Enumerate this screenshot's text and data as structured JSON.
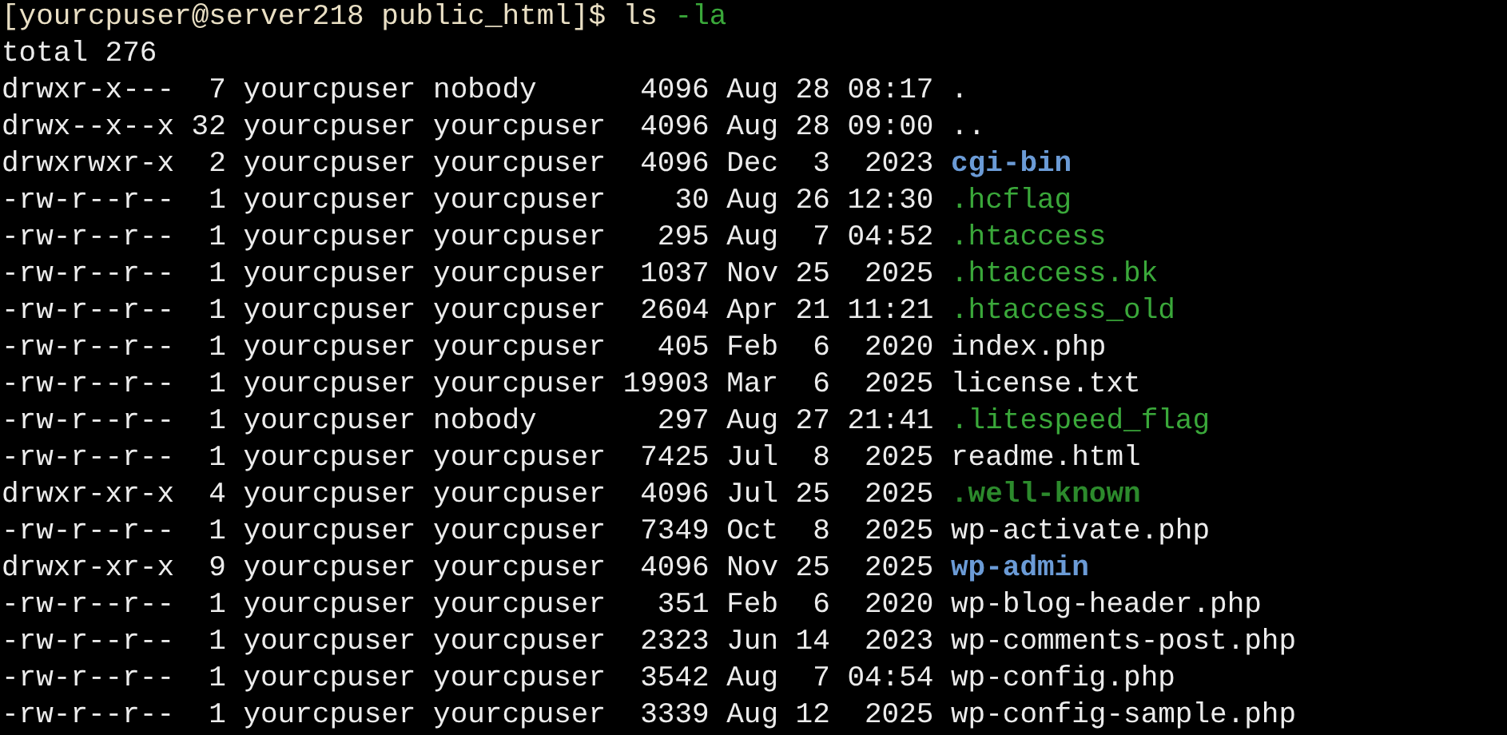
{
  "prompt": {
    "context": "[yourcpuser@server218 public_html]$",
    "command": "ls",
    "option": "-la"
  },
  "total": "total 276",
  "entries": [
    {
      "perms": "drwxr-x---",
      "links": "7",
      "owner": "yourcpuser",
      "group": "nobody",
      "size": "4096",
      "month": "Aug",
      "day": "28",
      "time": "08:17",
      "name": ".",
      "kind": "plain"
    },
    {
      "perms": "drwx--x--x",
      "links": "32",
      "owner": "yourcpuser",
      "group": "yourcpuser",
      "size": "4096",
      "month": "Aug",
      "day": "28",
      "time": "09:00",
      "name": "..",
      "kind": "plain"
    },
    {
      "perms": "drwxrwxr-x",
      "links": "2",
      "owner": "yourcpuser",
      "group": "yourcpuser",
      "size": "4096",
      "month": "Dec",
      "day": "3",
      "time": "2023",
      "name": "cgi-bin",
      "kind": "directory"
    },
    {
      "perms": "-rw-r--r--",
      "links": "1",
      "owner": "yourcpuser",
      "group": "yourcpuser",
      "size": "30",
      "month": "Aug",
      "day": "26",
      "time": "12:30",
      "name": ".hcflag",
      "kind": "hidden"
    },
    {
      "perms": "-rw-r--r--",
      "links": "1",
      "owner": "yourcpuser",
      "group": "yourcpuser",
      "size": "295",
      "month": "Aug",
      "day": "7",
      "time": "04:52",
      "name": ".htaccess",
      "kind": "hidden"
    },
    {
      "perms": "-rw-r--r--",
      "links": "1",
      "owner": "yourcpuser",
      "group": "yourcpuser",
      "size": "1037",
      "month": "Nov",
      "day": "25",
      "time": "2025",
      "name": ".htaccess.bk",
      "kind": "hidden"
    },
    {
      "perms": "-rw-r--r--",
      "links": "1",
      "owner": "yourcpuser",
      "group": "yourcpuser",
      "size": "2604",
      "month": "Apr",
      "day": "21",
      "time": "11:21",
      "name": ".htaccess_old",
      "kind": "hidden"
    },
    {
      "perms": "-rw-r--r--",
      "links": "1",
      "owner": "yourcpuser",
      "group": "yourcpuser",
      "size": "405",
      "month": "Feb",
      "day": "6",
      "time": "2020",
      "name": "index.php",
      "kind": "plain"
    },
    {
      "perms": "-rw-r--r--",
      "links": "1",
      "owner": "yourcpuser",
      "group": "yourcpuser",
      "size": "19903",
      "month": "Mar",
      "day": "6",
      "time": "2025",
      "name": "license.txt",
      "kind": "plain"
    },
    {
      "perms": "-rw-r--r--",
      "links": "1",
      "owner": "yourcpuser",
      "group": "nobody",
      "size": "297",
      "month": "Aug",
      "day": "27",
      "time": "21:41",
      "name": ".litespeed_flag",
      "kind": "hidden"
    },
    {
      "perms": "-rw-r--r--",
      "links": "1",
      "owner": "yourcpuser",
      "group": "yourcpuser",
      "size": "7425",
      "month": "Jul",
      "day": "8",
      "time": "2025",
      "name": "readme.html",
      "kind": "plain"
    },
    {
      "perms": "drwxr-xr-x",
      "links": "4",
      "owner": "yourcpuser",
      "group": "yourcpuser",
      "size": "4096",
      "month": "Jul",
      "day": "25",
      "time": "2025",
      "name": ".well-known",
      "kind": "hidden-directory"
    },
    {
      "perms": "-rw-r--r--",
      "links": "1",
      "owner": "yourcpuser",
      "group": "yourcpuser",
      "size": "7349",
      "month": "Oct",
      "day": "8",
      "time": "2025",
      "name": "wp-activate.php",
      "kind": "plain"
    },
    {
      "perms": "drwxr-xr-x",
      "links": "9",
      "owner": "yourcpuser",
      "group": "yourcpuser",
      "size": "4096",
      "month": "Nov",
      "day": "25",
      "time": "2025",
      "name": "wp-admin",
      "kind": "directory"
    },
    {
      "perms": "-rw-r--r--",
      "links": "1",
      "owner": "yourcpuser",
      "group": "yourcpuser",
      "size": "351",
      "month": "Feb",
      "day": "6",
      "time": "2020",
      "name": "wp-blog-header.php",
      "kind": "plain"
    },
    {
      "perms": "-rw-r--r--",
      "links": "1",
      "owner": "yourcpuser",
      "group": "yourcpuser",
      "size": "2323",
      "month": "Jun",
      "day": "14",
      "time": "2023",
      "name": "wp-comments-post.php",
      "kind": "plain"
    },
    {
      "perms": "-rw-r--r--",
      "links": "1",
      "owner": "yourcpuser",
      "group": "yourcpuser",
      "size": "3542",
      "month": "Aug",
      "day": "7",
      "time": "04:54",
      "name": "wp-config.php",
      "kind": "plain"
    },
    {
      "perms": "-rw-r--r--",
      "links": "1",
      "owner": "yourcpuser",
      "group": "yourcpuser",
      "size": "3339",
      "month": "Aug",
      "day": "12",
      "time": "2025",
      "name": "wp-config-sample.php",
      "kind": "plain"
    }
  ]
}
